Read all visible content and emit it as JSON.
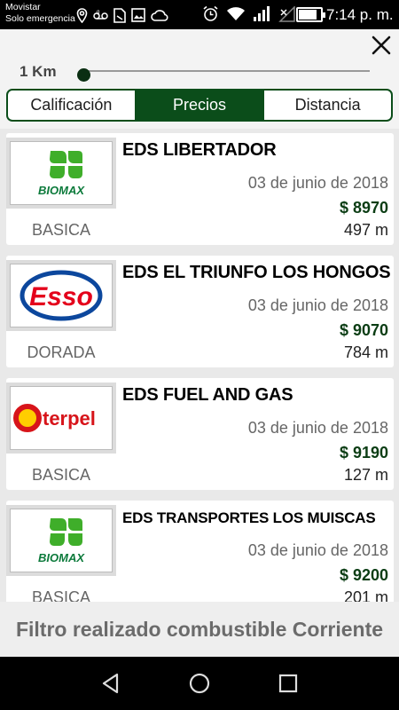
{
  "status_bar": {
    "carrier": "Movistar",
    "carrier_sub": "Solo emergencia",
    "time": "7:14 p. m.",
    "battery_level": 0.85,
    "icons": [
      "location-icon",
      "voicemail-icon",
      "sim-icon",
      "image-icon",
      "cloud-icon",
      "alarm-icon",
      "wifi-icon",
      "signal-icon",
      "no-signal-icon",
      "battery-icon"
    ]
  },
  "filter": {
    "distance_label": "1 Km",
    "slider_value": 0.0
  },
  "tabs": [
    {
      "label": "Calificación",
      "active": false
    },
    {
      "label": "Precios",
      "active": true
    },
    {
      "label": "Distancia",
      "active": false
    }
  ],
  "stations": [
    {
      "name": "EDS LIBERTADOR",
      "date": "03 de junio de 2018",
      "price": "$ 8970",
      "distance": "497 m",
      "fuel_type": "BASICA",
      "brand": "BIOMAX"
    },
    {
      "name": "EDS EL TRIUNFO LOS HONGOS",
      "date": "03 de junio de 2018",
      "price": "$ 9070",
      "distance": "784 m",
      "fuel_type": "DORADA",
      "brand": "Esso"
    },
    {
      "name": "EDS FUEL AND GAS",
      "date": "03 de junio de 2018",
      "price": "$ 9190",
      "distance": "127 m",
      "fuel_type": "BASICA",
      "brand": "terpel"
    },
    {
      "name": "EDS TRANSPORTES LOS MUISCAS",
      "date": "03 de junio de 2018",
      "price": "$ 9200",
      "distance": "201 m",
      "fuel_type": "BASICA",
      "brand": "BIOMAX"
    }
  ],
  "footer": {
    "text": "Filtro realizado combustible Corriente"
  },
  "colors": {
    "primary_green": "#0b4d1a",
    "price_green": "#0b3d14",
    "esso_red": "#e4001b",
    "esso_blue": "#0c479d",
    "terpel_red": "#d7141a",
    "terpel_yellow": "#ffcd00",
    "biomax_green": "#3fae2a"
  }
}
